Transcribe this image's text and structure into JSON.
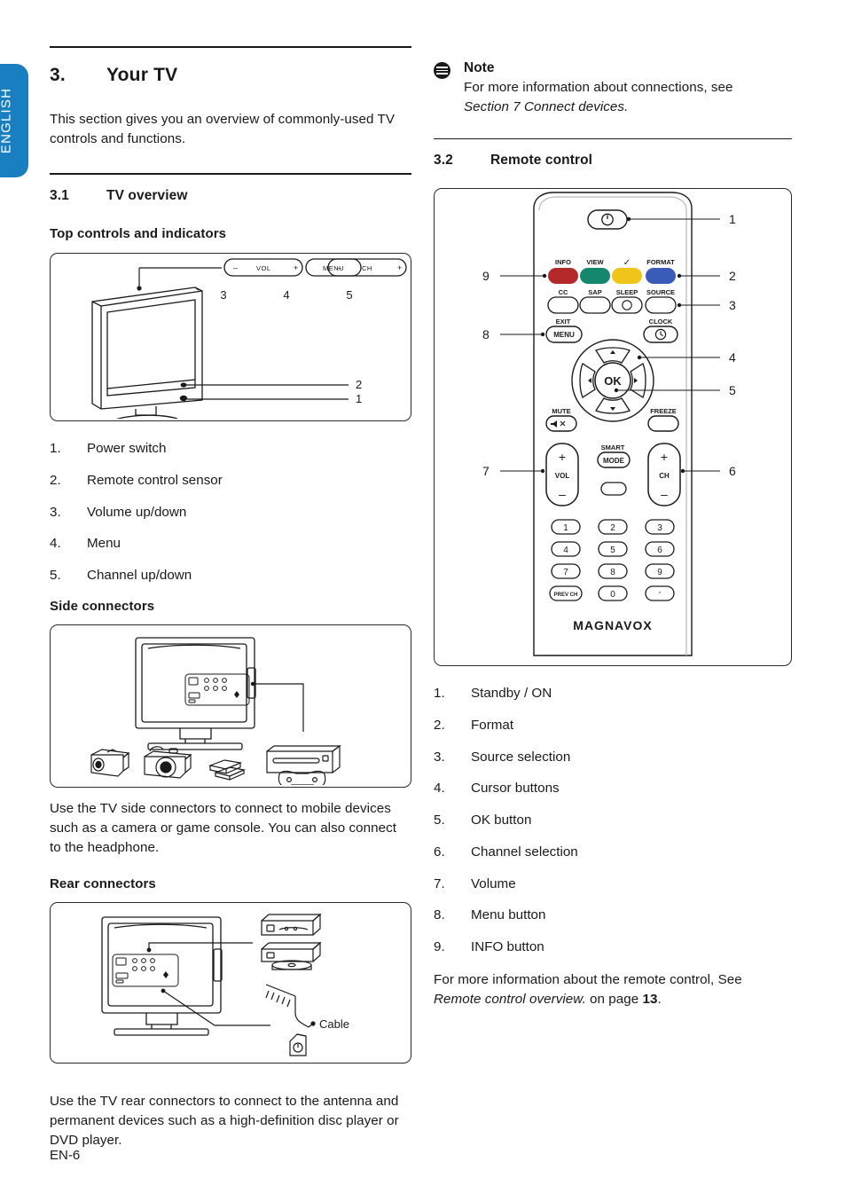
{
  "sidebar_tab": {
    "label": "ENGLISH",
    "color": "#1a7fc1"
  },
  "footer": {
    "page_label": "EN-6"
  },
  "left_column": {
    "section": {
      "number": "3.",
      "title": "Your TV"
    },
    "intro": "This section gives you an overview of commonly-used TV controls and functions.",
    "subsection": {
      "number": "3.1",
      "title": "TV overview"
    },
    "fig1_heading": "Top controls and indicators",
    "fig1": {
      "buttons": [
        {
          "minus": "–",
          "label": "VOL",
          "plus": "+"
        },
        {
          "label": "MENU"
        },
        {
          "minus": "–",
          "label": "CH",
          "plus": "+"
        }
      ],
      "callouts": [
        "3",
        "4",
        "5",
        "2",
        "1"
      ]
    },
    "list1": [
      {
        "n": "1.",
        "label": "Power switch"
      },
      {
        "n": "2.",
        "label": "Remote control sensor"
      },
      {
        "n": "3.",
        "label": "Volume up/down"
      },
      {
        "n": "4.",
        "label": "Menu"
      },
      {
        "n": "5.",
        "label": "Channel up/down"
      }
    ],
    "fig2_heading": "Side connectors",
    "fig2": {
      "devices": [
        "camcorder",
        "camera",
        "usb-drive",
        "game-console"
      ]
    },
    "para2": "Use the TV side connectors to connect to mobile devices such as a camera or game console. You can also connect to the headphone.",
    "fig3_heading": "Rear connectors",
    "fig3": {
      "cable_label": "Cable",
      "devices": [
        "disc-player-top",
        "disc-player-bottom",
        "antenna",
        "wall-outlet"
      ]
    },
    "para3": "Use the TV rear connectors to connect to the antenna and permanent devices such as a high-definition disc player or DVD player."
  },
  "right_column": {
    "note": {
      "title": "Note",
      "line1": "For more information about connections, see",
      "line2_italic": "Section 7 Connect devices."
    },
    "subsection": {
      "number": "3.2",
      "title": "Remote control"
    },
    "remote": {
      "brand": "MAGNAVOX",
      "power_icon": "power-icon",
      "color_buttons": [
        {
          "label": "INFO",
          "color": "#b5282a"
        },
        {
          "label": "VIEW",
          "color": "#15876d"
        },
        {
          "label": "✓",
          "color": "#f0c419"
        },
        {
          "label": "FORMAT",
          "color": "#3a5bb8"
        }
      ],
      "row2_buttons": [
        "CC",
        "SAP",
        "SLEEP",
        "SOURCE"
      ],
      "exit_label": "EXIT",
      "menu_label": "MENU",
      "clock_label": "CLOCK",
      "ok_label": "OK",
      "mute_label": "MUTE",
      "freeze_label": "FREEZE",
      "vol_label": "VOL",
      "ch_label": "CH",
      "smart_label": "SMART",
      "mode_label": "MODE",
      "plus": "+",
      "minus": "–",
      "keypad": [
        "1",
        "2",
        "3",
        "4",
        "5",
        "6",
        "7",
        "8",
        "9",
        "PREV CH",
        "0",
        "·"
      ],
      "callouts_right": [
        "1",
        "2",
        "3",
        "4",
        "5",
        "6"
      ],
      "callouts_left": [
        "9",
        "8",
        "7"
      ]
    },
    "list2": [
      {
        "n": "1.",
        "label": "Standby / ON"
      },
      {
        "n": "2.",
        "label": "Format"
      },
      {
        "n": "3.",
        "label": "Source selection"
      },
      {
        "n": "4.",
        "label": "Cursor buttons"
      },
      {
        "n": "5.",
        "label": "OK button"
      },
      {
        "n": "6.",
        "label": "Channel selection"
      },
      {
        "n": "7.",
        "label": "Volume"
      },
      {
        "n": "8.",
        "label": "Menu button"
      },
      {
        "n": "9.",
        "label": "INFO button"
      }
    ],
    "closing": {
      "part1": "For more information about the remote control, See",
      "italic": "Remote control overview.",
      "part2": "on page",
      "page": "13",
      "period": "."
    }
  }
}
